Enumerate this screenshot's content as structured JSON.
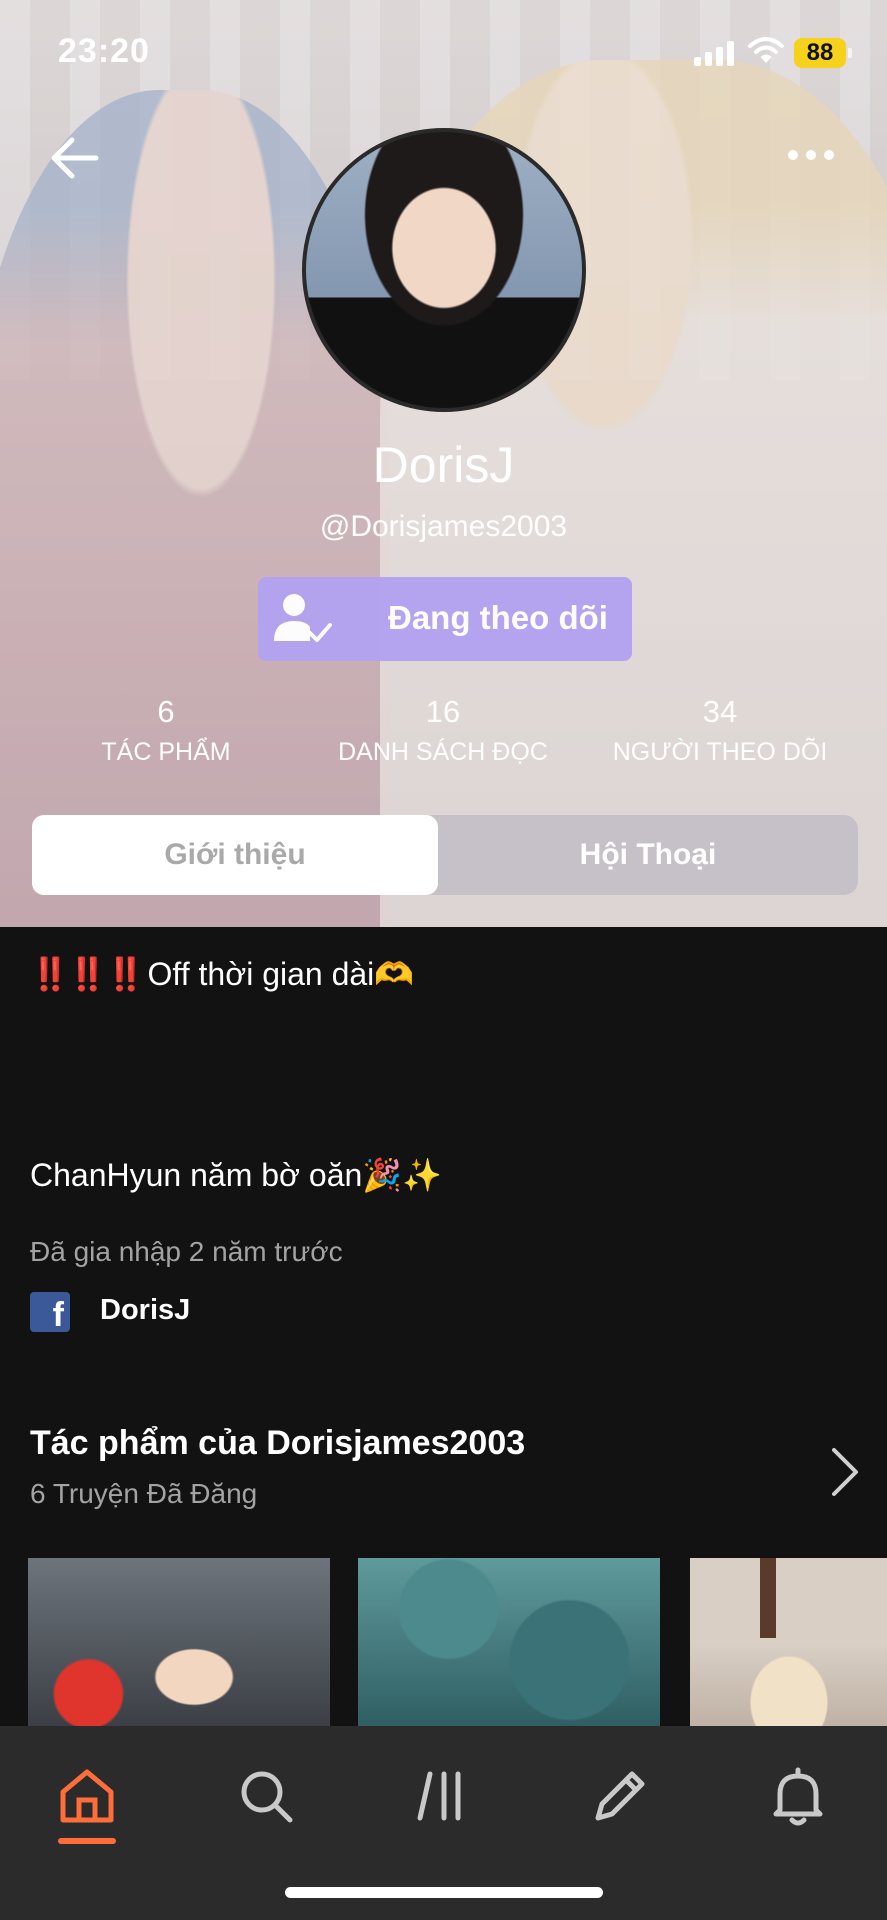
{
  "status_bar": {
    "time": "23:20",
    "battery": "88"
  },
  "profile": {
    "display_name": "DorisJ",
    "handle": "@Dorisjames2003",
    "follow_label": "Đang theo dõi"
  },
  "stats": [
    {
      "value": "6",
      "label": "TÁC PHẨM"
    },
    {
      "value": "16",
      "label": "DANH SÁCH ĐỌC"
    },
    {
      "value": "34",
      "label": "NGƯỜI THEO DÕI"
    }
  ],
  "tabs": [
    {
      "label": "Giới thiệu",
      "active": true
    },
    {
      "label": "Hội Thoại",
      "active": false
    }
  ],
  "bio": {
    "line1_marks": "‼️‼️‼️",
    "line1_text": "Off thời gian dài🫶",
    "line2": "ChanHyun năm bờ oăn🎉✨"
  },
  "joined": "Đã gia nhập 2 năm trước",
  "facebook": {
    "icon": "facebook-icon",
    "name": "DorisJ"
  },
  "works": {
    "title": "Tác phẩm của Dorisjames2003",
    "subtitle": "6 Truyện Đã Đăng"
  },
  "bottom_nav": [
    {
      "icon": "home-icon",
      "active": true
    },
    {
      "icon": "search-icon",
      "active": false
    },
    {
      "icon": "library-icon",
      "active": false
    },
    {
      "icon": "pencil-icon",
      "active": false
    },
    {
      "icon": "bell-icon",
      "active": false
    }
  ],
  "colors": {
    "accent": "#ff6d3b",
    "follow_button": "#b3a2f0",
    "background": "#121212",
    "nav": "#2b2b2b"
  }
}
